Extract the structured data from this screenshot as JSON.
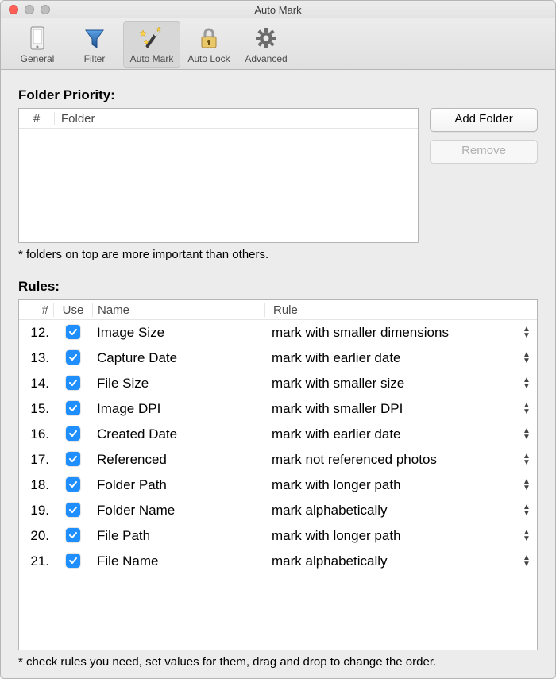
{
  "window": {
    "title": "Auto Mark"
  },
  "toolbar": {
    "items": [
      {
        "id": "general",
        "label": "General"
      },
      {
        "id": "filter",
        "label": "Filter"
      },
      {
        "id": "automark",
        "label": "Auto Mark",
        "selected": true
      },
      {
        "id": "autolock",
        "label": "Auto Lock"
      },
      {
        "id": "advanced",
        "label": "Advanced"
      }
    ]
  },
  "folder": {
    "section_label": "Folder Priority:",
    "header_num": "#",
    "header_folder": "Folder",
    "add_button": "Add Folder",
    "remove_button": "Remove",
    "hint": "* folders on top are more important than others."
  },
  "rules": {
    "section_label": "Rules:",
    "header_num": "#",
    "header_use": "Use",
    "header_name": "Name",
    "header_rule": "Rule",
    "hint": "* check rules you need, set values for them, drag and drop to change the order.",
    "rows": [
      {
        "num": "12.",
        "use": true,
        "name": "Image Size",
        "rule": "mark with smaller dimensions"
      },
      {
        "num": "13.",
        "use": true,
        "name": "Capture Date",
        "rule": "mark with earlier date"
      },
      {
        "num": "14.",
        "use": true,
        "name": "File Size",
        "rule": "mark with smaller size"
      },
      {
        "num": "15.",
        "use": true,
        "name": "Image DPI",
        "rule": "mark with smaller DPI"
      },
      {
        "num": "16.",
        "use": true,
        "name": "Created Date",
        "rule": "mark with earlier date"
      },
      {
        "num": "17.",
        "use": true,
        "name": "Referenced",
        "rule": "mark not referenced photos"
      },
      {
        "num": "18.",
        "use": true,
        "name": "Folder Path",
        "rule": "mark with longer path"
      },
      {
        "num": "19.",
        "use": true,
        "name": "Folder Name",
        "rule": "mark alphabetically"
      },
      {
        "num": "20.",
        "use": true,
        "name": "File Path",
        "rule": "mark with longer path"
      },
      {
        "num": "21.",
        "use": true,
        "name": "File Name",
        "rule": "mark alphabetically"
      }
    ]
  }
}
